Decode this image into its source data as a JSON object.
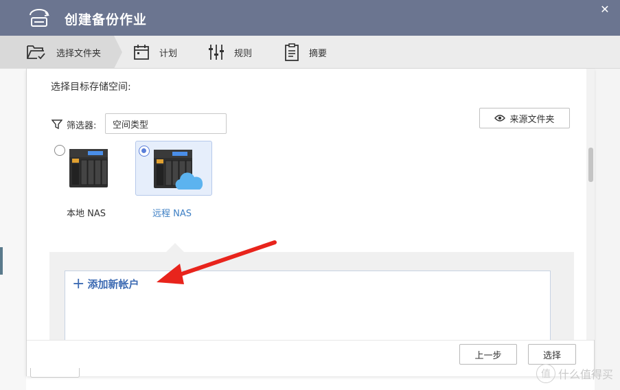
{
  "window": {
    "title": "创建备份作业",
    "close_symbol": "✕",
    "icon": "backup-drive-icon"
  },
  "steps": [
    {
      "label": "选择文件夹",
      "icon": "folder-check-icon",
      "active": true
    },
    {
      "label": "计划",
      "icon": "calendar-icon",
      "active": false
    },
    {
      "label": "规则",
      "icon": "sliders-icon",
      "active": false
    },
    {
      "label": "摘要",
      "icon": "clipboard-icon",
      "active": false
    }
  ],
  "content": {
    "prompt": "选择目标存储空间:",
    "filter": {
      "label": "筛选器:",
      "value": "空间类型",
      "icon": "filter-icon"
    },
    "source_button": {
      "label": "来源文件夹",
      "icon": "eye-icon"
    },
    "options": [
      {
        "label": "本地 NAS",
        "selected": false,
        "icon": "nas-device-icon"
      },
      {
        "label": "远程 NAS",
        "selected": true,
        "icon": "nas-cloud-icon"
      }
    ],
    "add_account": {
      "label": "添加新帐户",
      "icon": "plus-icon"
    }
  },
  "footer": {
    "back_label": "上一步",
    "select_label": "选择"
  },
  "watermark": {
    "text": "什么值得买",
    "logo": "值"
  },
  "colors": {
    "titlebar": "#6b7590",
    "accent": "#3d6bb3",
    "selected_bg": "#e6eefb",
    "annotation": "#e8241c"
  }
}
